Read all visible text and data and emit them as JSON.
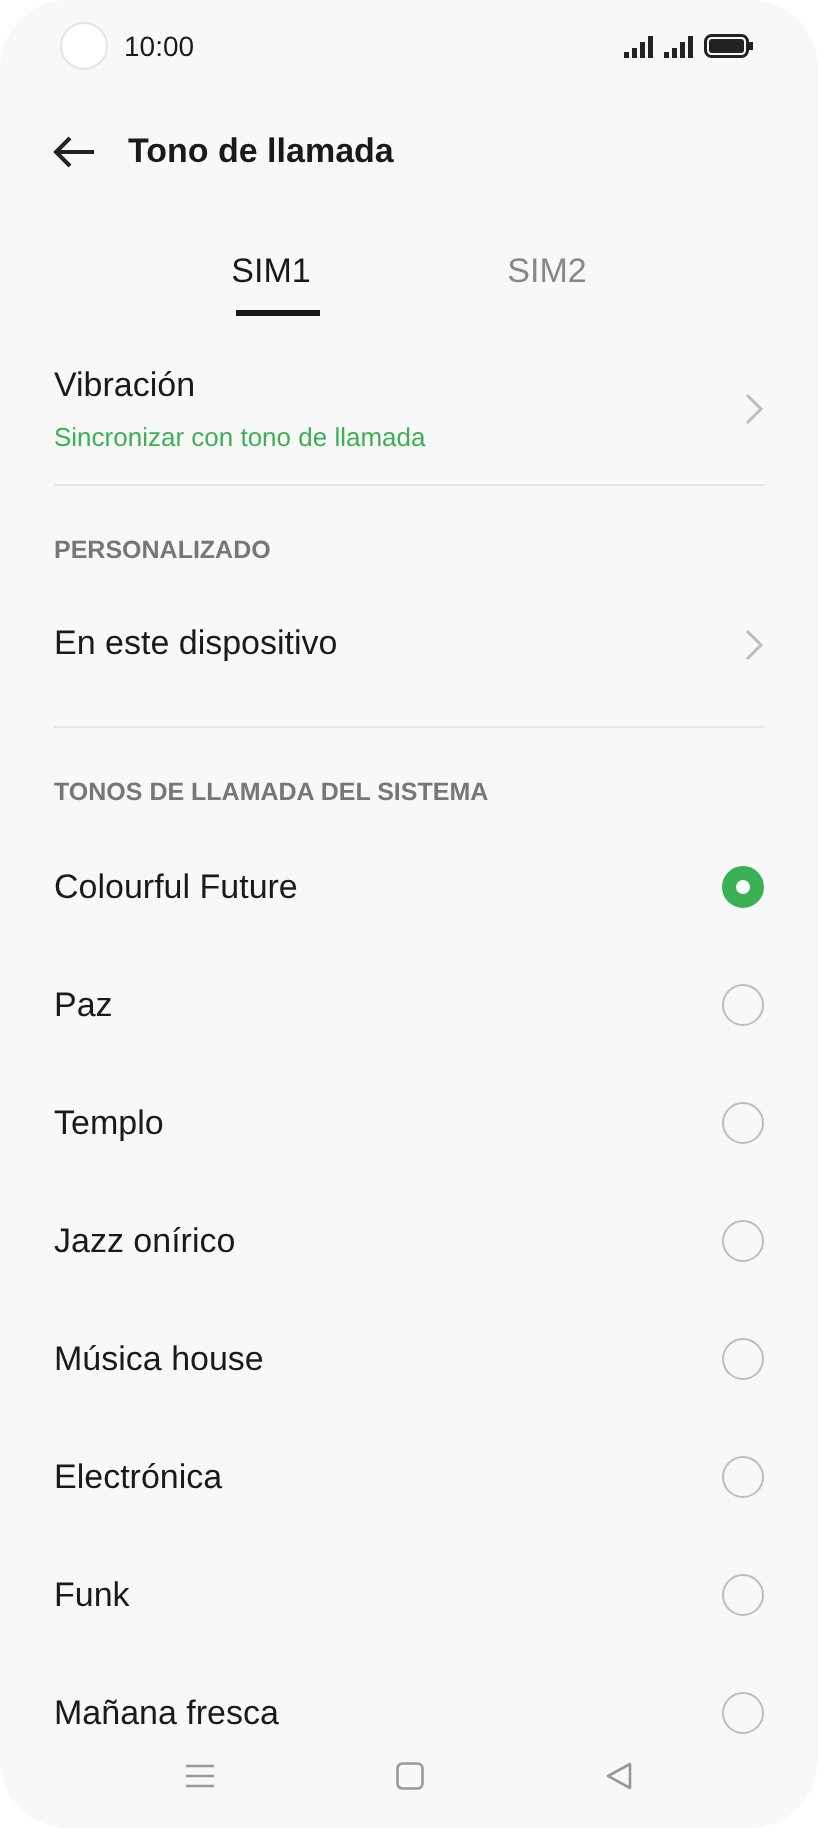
{
  "status_bar": {
    "time": "10:00"
  },
  "header": {
    "title": "Tono de llamada"
  },
  "tabs": [
    {
      "label": "SIM1",
      "selected": true
    },
    {
      "label": "SIM2",
      "selected": false
    }
  ],
  "vibration": {
    "title": "Vibración",
    "subtitle": "Sincronizar con tono de llamada"
  },
  "custom": {
    "heading": "PERSONALIZADO",
    "item": "En este dispositivo"
  },
  "system": {
    "heading": "TONOS DE LLAMADA DEL SISTEMA",
    "ringtones": [
      {
        "label": "Colourful Future",
        "selected": true
      },
      {
        "label": "Paz",
        "selected": false
      },
      {
        "label": "Templo",
        "selected": false
      },
      {
        "label": "Jazz onírico",
        "selected": false
      },
      {
        "label": "Música house",
        "selected": false
      },
      {
        "label": "Electrónica",
        "selected": false
      },
      {
        "label": "Funk",
        "selected": false
      },
      {
        "label": "Mañana fresca",
        "selected": false
      }
    ]
  }
}
